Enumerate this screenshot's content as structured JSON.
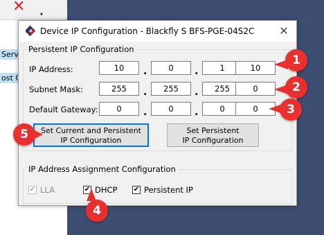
{
  "background": {
    "tree_item_1": "Serv",
    "tree_item_2": "ost C"
  },
  "dialog": {
    "title": "Device IP Configuration - Blackfly S BFS-PGE-04S2C",
    "close_glyph": "✕",
    "persistent_group": {
      "legend": "Persistent IP Configuration",
      "rows": [
        {
          "label": "IP Address:",
          "octets": [
            "10",
            "0",
            "1",
            "10"
          ]
        },
        {
          "label": "Subnet Mask:",
          "octets": [
            "255",
            "255",
            "255",
            "0"
          ]
        },
        {
          "label": "Default Gateway:",
          "octets": [
            "0",
            "0",
            "0",
            "0"
          ]
        }
      ],
      "dot": "."
    },
    "buttons": {
      "set_current_persistent": "Set Current and Persistent\nIP Configuration",
      "set_persistent": "Set Persistent\nIP Configuration"
    },
    "assignment_group": {
      "legend": "IP Address Assignment Configuration",
      "options": [
        {
          "label": "LLA",
          "checked": true,
          "enabled": false
        },
        {
          "label": "DHCP",
          "checked": true,
          "enabled": true
        },
        {
          "label": "Persistent IP",
          "checked": true,
          "enabled": true
        }
      ]
    }
  },
  "annotations": [
    "1",
    "2",
    "3",
    "4",
    "5"
  ],
  "colors": {
    "callout": "#e8312f",
    "desktop": "#3d4e72",
    "focus": "#0078d7"
  },
  "icons": {
    "background_close": "close-icon",
    "title": "device-icon",
    "check": "checkmark-icon"
  }
}
